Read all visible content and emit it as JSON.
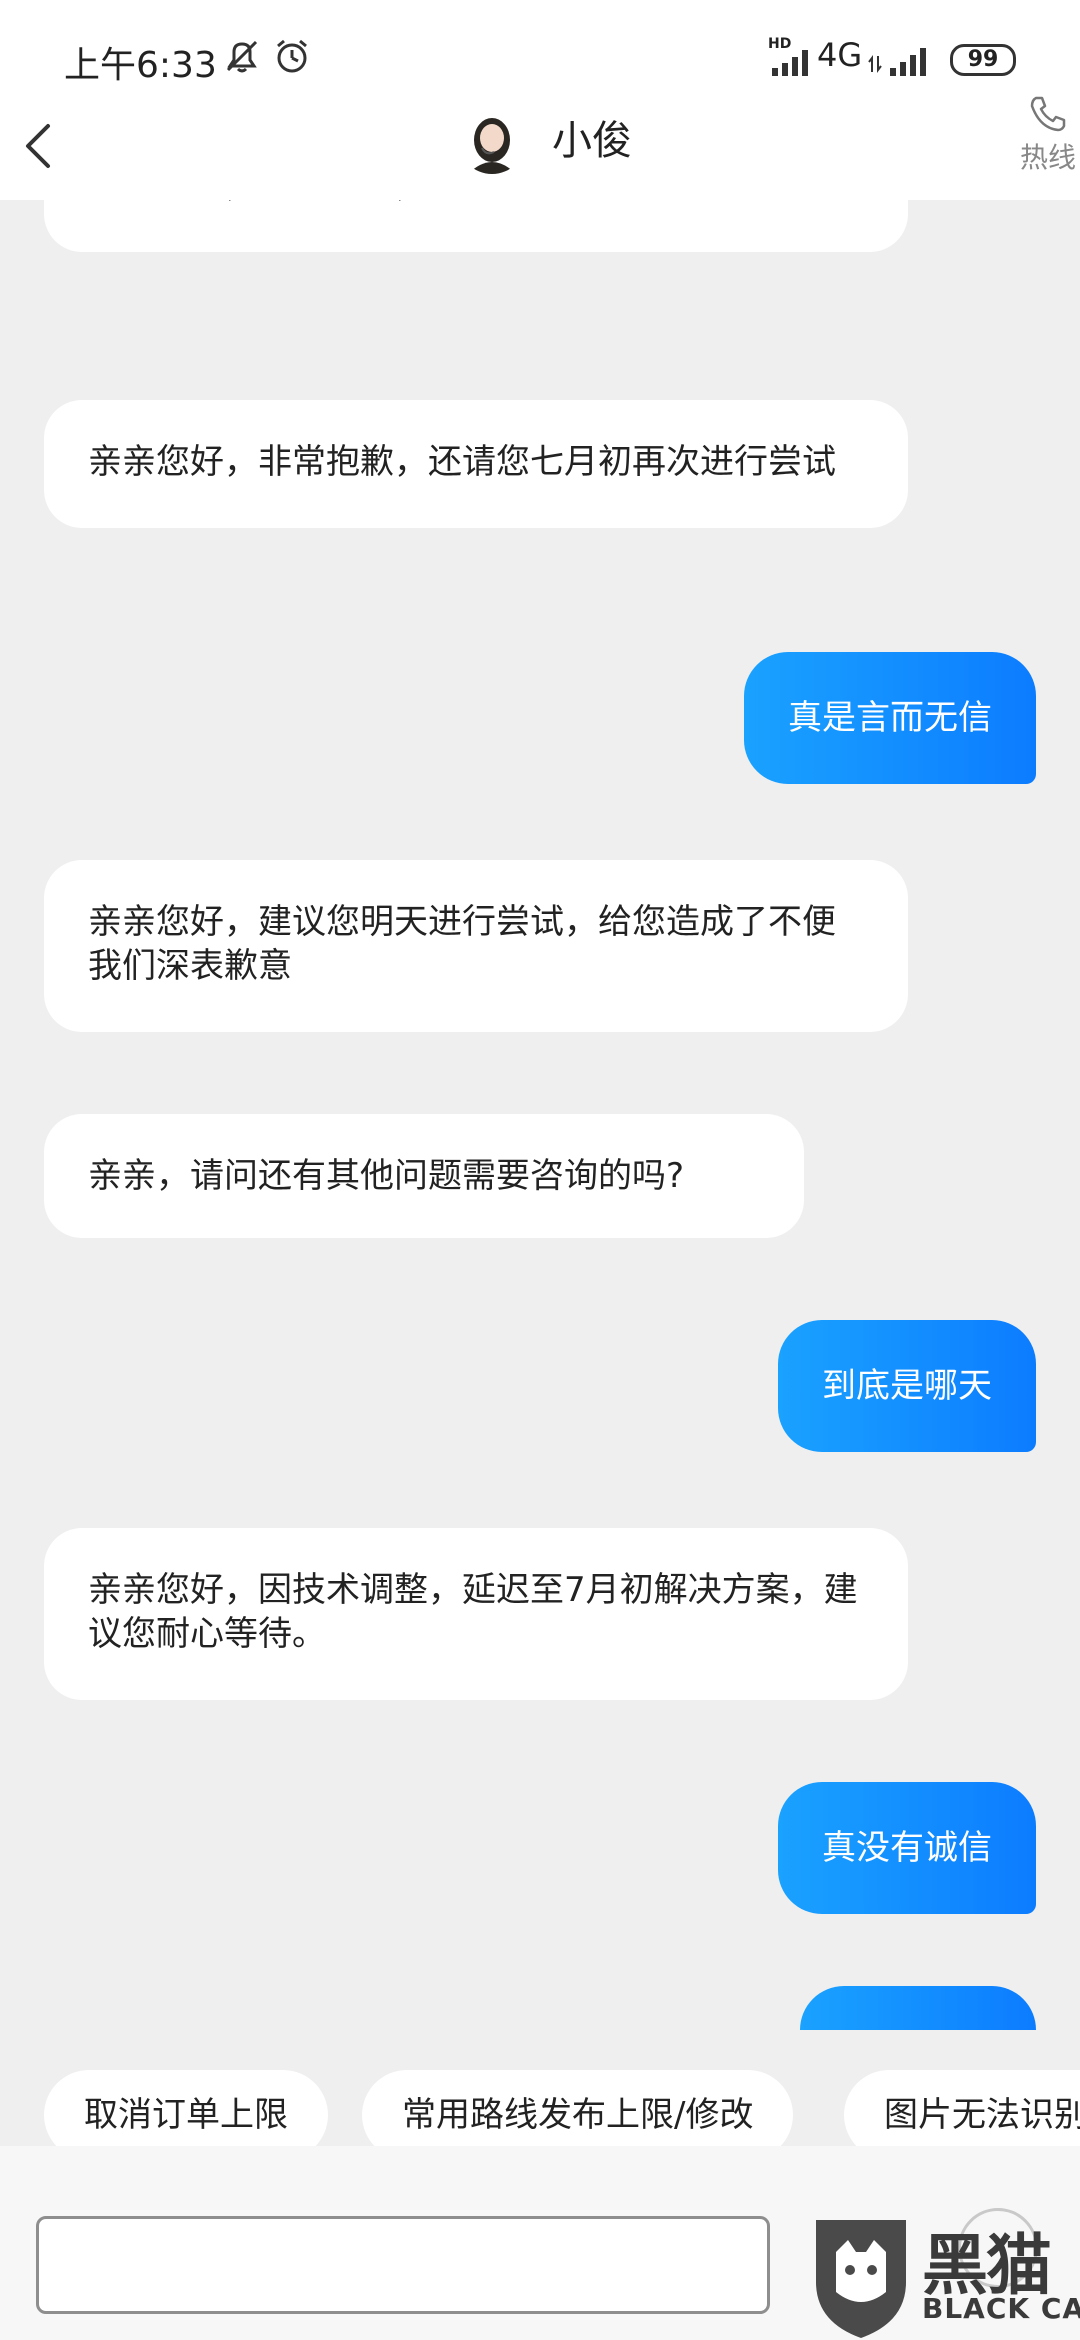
{
  "status_bar": {
    "time": "上午6:33",
    "network": "4G",
    "hd": "HD",
    "battery": "99",
    "icons": [
      "mute-bell-icon",
      "alarm-icon",
      "signal-icon",
      "data-arrows-icon",
      "signal-icon-2",
      "battery-icon"
    ]
  },
  "header": {
    "title": "小俊",
    "hotline_label": "热线",
    "icons": [
      "back-chevron-icon",
      "phone-icon"
    ]
  },
  "messages": [
    {
      "sender": "agent",
      "text": "亲亲您好，非常抱歉，还请您七月初再次进行尝试"
    },
    {
      "sender": "agent",
      "text": "亲亲您好，非常抱歉，还请您七月初再次进行尝试"
    },
    {
      "sender": "user",
      "text": "真是言而无信"
    },
    {
      "sender": "agent",
      "text": "亲亲您好，建议您明天进行尝试，给您造成了不便我们深表歉意"
    },
    {
      "sender": "agent",
      "text": "亲亲，请问还有其他问题需要咨询的吗?"
    },
    {
      "sender": "user",
      "text": "到底是哪天"
    },
    {
      "sender": "agent",
      "text": "亲亲您好，因技术调整，延迟至7月初解决方案，建议您耐心等待。"
    },
    {
      "sender": "user",
      "text": "真没有诚信"
    },
    {
      "sender": "user",
      "text": ""
    }
  ],
  "quick_replies": [
    "取消订单上限",
    "常用路线发布上限/修改",
    "图片无法识别"
  ],
  "input": {
    "value": "",
    "placeholder": ""
  },
  "watermark": {
    "cn": "黑猫",
    "en": "BLACK CAT"
  },
  "colors": {
    "user_bubble": "#0c8cff",
    "agent_bubble": "#ffffff",
    "background": "#efefef"
  }
}
